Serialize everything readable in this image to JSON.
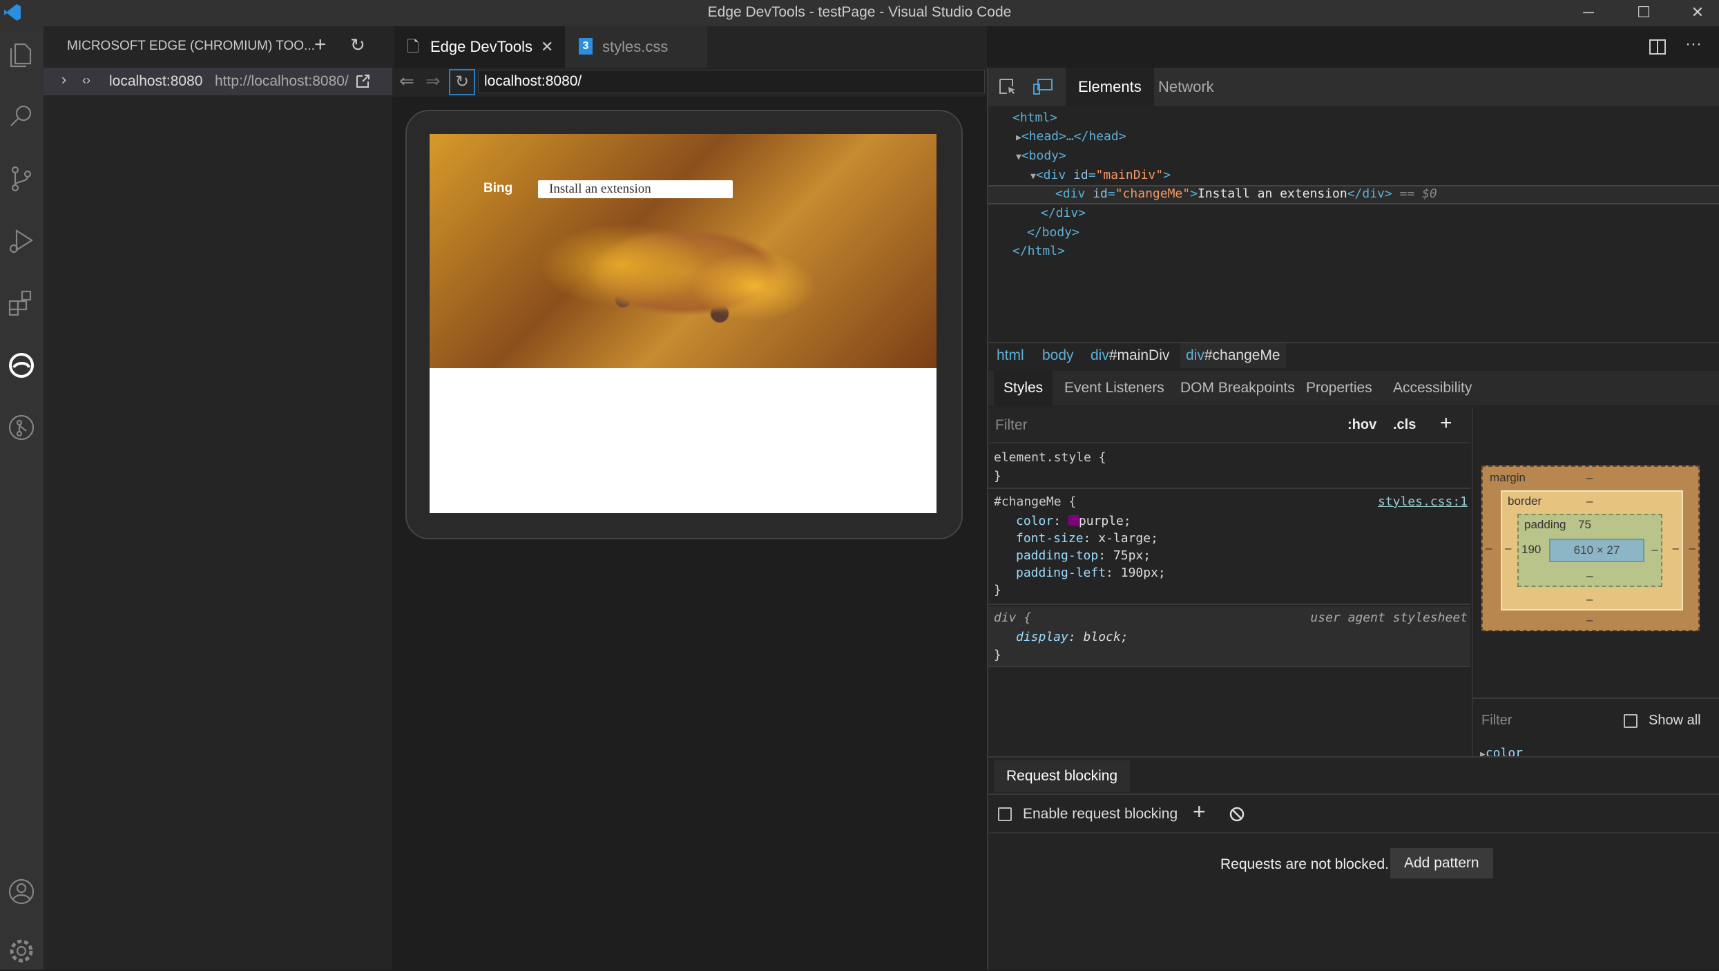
{
  "window": {
    "title": "Edge DevTools - testPage - Visual Studio Code",
    "minimize": "─",
    "maximize": "☐",
    "close": "✕"
  },
  "activity_bar": [
    "explorer-icon",
    "search-icon",
    "source-control-icon",
    "run-debug-icon",
    "extensions-icon",
    "edge-devtools-icon",
    "git-graph-icon",
    "account-icon",
    "settings-icon"
  ],
  "side_panel": {
    "header": "MICROSOFT EDGE (CHROMIUM) TOO...",
    "add": "+",
    "refresh": "↻",
    "target": {
      "name": "localhost:8080",
      "url": "http://localhost:8080/"
    }
  },
  "editor_tabs": [
    {
      "label": "Edge DevTools",
      "active": true,
      "close": "✕"
    },
    {
      "label": "styles.css",
      "active": false
    }
  ],
  "navbar": {
    "url": "localhost:8080/"
  },
  "page": {
    "bing": "Bing",
    "search_text": "Install an extension"
  },
  "devtools": {
    "tabs": [
      "Elements",
      "Network"
    ],
    "dom": {
      "html_open": "<html>",
      "head": "<head>…</head>",
      "body_open": "<body>",
      "maindiv_open_a": "<div ",
      "maindiv_attr": "id",
      "maindiv_val": "\"mainDiv\"",
      "maindiv_close_a": ">",
      "sel_open": "<div ",
      "sel_attr": "id",
      "sel_val": "\"changeMe\"",
      "sel_gt": ">",
      "sel_text": "Install an extension",
      "sel_close": "</div>",
      "sel_marker": " == $0",
      "div_close": "</div>",
      "body_close": "</body>",
      "html_close": "</html>"
    },
    "breadcrumbs": [
      {
        "tag": "html",
        "id": ""
      },
      {
        "tag": "body",
        "id": ""
      },
      {
        "tag": "div",
        "id": "#mainDiv"
      },
      {
        "tag": "div",
        "id": "#changeMe"
      }
    ],
    "styles_tabs": [
      "Styles",
      "Event Listeners",
      "DOM Breakpoints",
      "Properties",
      "Accessibility"
    ],
    "styles": {
      "filter_placeholder": "Filter",
      "hov": ":hov",
      "cls": ".cls",
      "add": "+",
      "element_style": "element.style {",
      "close_brace": "}",
      "rule1": {
        "selector": "#changeMe {",
        "source": "styles.css:1",
        "props": [
          {
            "name": "color",
            "value": "purple;",
            "swatch": "#800080"
          },
          {
            "name": "font-size",
            "value": "x-large;"
          },
          {
            "name": "padding-top",
            "value": "75px;"
          },
          {
            "name": "padding-left",
            "value": "190px;"
          }
        ]
      },
      "rule2": {
        "selector": "div {",
        "source": "user agent stylesheet",
        "props": [
          {
            "name": "display",
            "value": "block;"
          }
        ]
      }
    },
    "box_model": {
      "margin_label": "margin",
      "border_label": "border",
      "padding_label": "padding",
      "dash": "–",
      "padding_top": "75",
      "padding_left": "190",
      "content": "610 × 27"
    },
    "computed": {
      "filter_placeholder": "Filter",
      "show_all": "Show all",
      "first_prop": "color"
    },
    "request_blocking": {
      "tab": "Request blocking",
      "enable": "Enable request blocking",
      "add": "+",
      "status": "Requests are not blocked.",
      "add_pattern": "Add pattern"
    }
  }
}
